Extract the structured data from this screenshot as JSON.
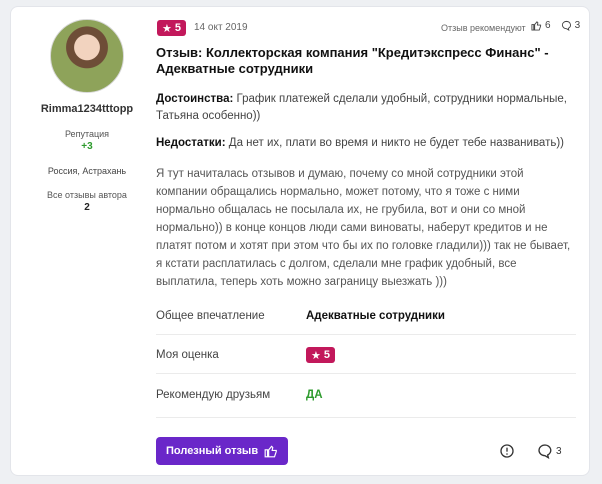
{
  "author": {
    "username": "Rimma1234tttopp",
    "reputation_label": "Репутация",
    "reputation_value": "+3",
    "location": "Россия, Астрахань",
    "all_reviews_label": "Все отзывы автора",
    "all_reviews_count": "2"
  },
  "review": {
    "rating": "5",
    "date": "14 окт 2019",
    "recommended_text": "Отзыв рекомендуют",
    "likes_count": "6",
    "comments_count": "3",
    "title": "Отзыв: Коллекторская компания \"Кредитэкспресс Финанс\" - Адекватные сотрудники",
    "pros_label": "Достоинства:",
    "pros_text": "График платежей сделали удобный, сотрудники нормальные, Татьяна особенно))",
    "cons_label": "Недостатки:",
    "cons_text": "Да нет их, плати во время и никто не будет тебе названивать))",
    "body_text": "Я тут начиталась отзывов и думаю, почему со мной сотрудники этой компании обращались нормально, может потому, что я тоже с ними нормально общалась не посылала их, не грубила, вот и они со мной нормально)) в конце концов люди сами виноваты, наберут кредитов и не платят потом и хотят при этом что бы их по головке гладили))) так не бывает, я кстати расплатилась с долгом, сделали мне график удобный, все выплатила, теперь хоть можно заграницу выезжать )))",
    "impression_label": "Общее впечатление",
    "impression_value": "Адекватные сотрудники",
    "my_rating_label": "Моя оценка",
    "my_rating_value": "5",
    "recommend_label": "Рекомендую друзьям",
    "recommend_value": "ДА"
  },
  "actions": {
    "useful_button": "Полезный отзыв",
    "bottom_comments_count": "3"
  },
  "colors": {
    "badge": "#c2185b",
    "button": "#6a27c9",
    "positive": "#2e9b2e"
  }
}
